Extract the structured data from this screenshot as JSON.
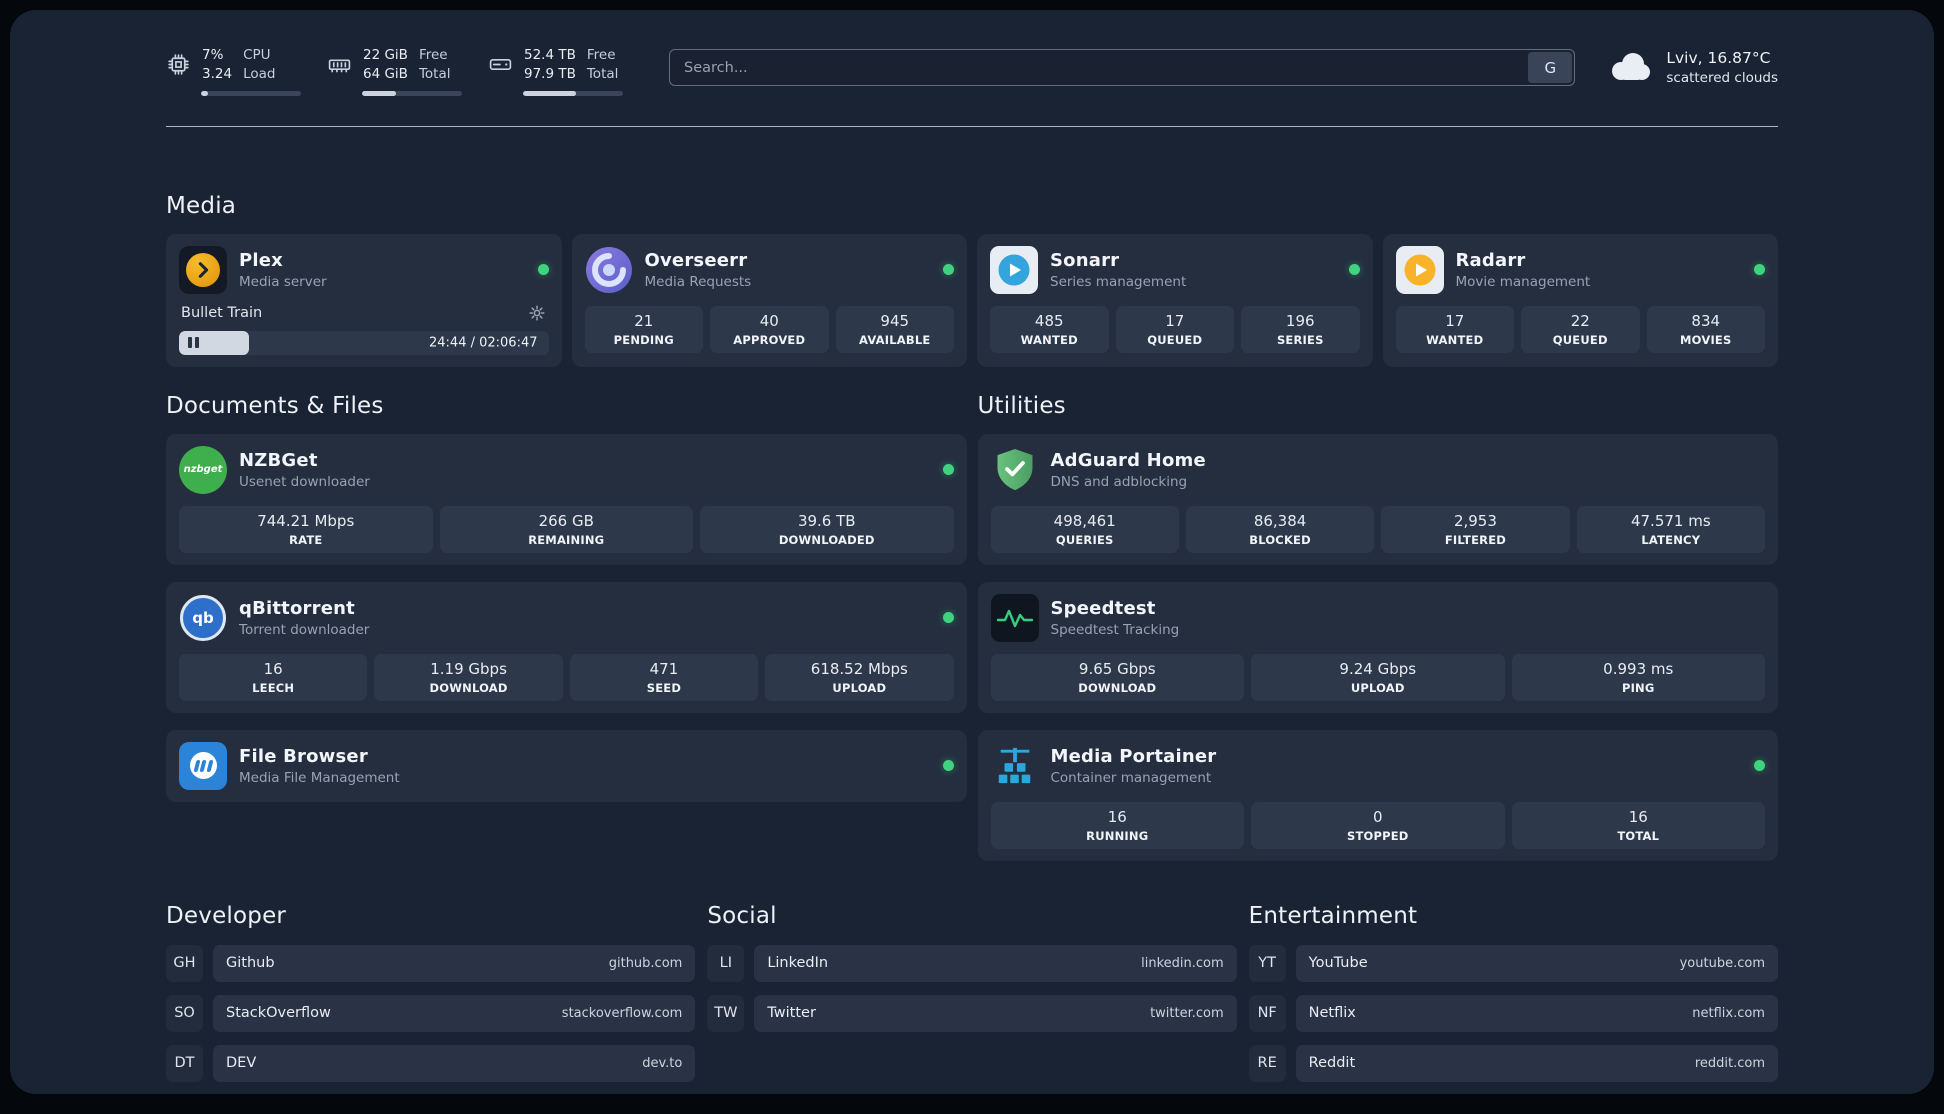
{
  "topbar": {
    "cpu": {
      "value": "7%",
      "value2": "3.24",
      "label1": "CPU",
      "label2": "Load",
      "percent": 7
    },
    "ram": {
      "value": "22 GiB",
      "value2": "64 GiB",
      "label1": "Free",
      "label2": "Total",
      "percent": 34
    },
    "disk": {
      "value": "52.4 TB",
      "value2": "97.9 TB",
      "label1": "Free",
      "label2": "Total",
      "percent": 53
    },
    "search": {
      "placeholder": "Search...",
      "engine_label": "G"
    },
    "weather": {
      "location": "Lviv, 16.87°C",
      "condition": "scattered clouds"
    }
  },
  "sections": {
    "media": {
      "title": "Media",
      "apps": [
        {
          "name": "Plex",
          "desc": "Media server",
          "status": "online",
          "player": {
            "title": "Bullet Train",
            "time": "24:44 / 02:06:47",
            "progress_percent": 19
          }
        },
        {
          "name": "Overseerr",
          "desc": "Media Requests",
          "status": "online",
          "stats": [
            {
              "value": "21",
              "label": "PENDING"
            },
            {
              "value": "40",
              "label": "APPROVED"
            },
            {
              "value": "945",
              "label": "AVAILABLE"
            }
          ]
        },
        {
          "name": "Sonarr",
          "desc": "Series management",
          "status": "online",
          "stats": [
            {
              "value": "485",
              "label": "WANTED"
            },
            {
              "value": "17",
              "label": "QUEUED"
            },
            {
              "value": "196",
              "label": "SERIES"
            }
          ]
        },
        {
          "name": "Radarr",
          "desc": "Movie management",
          "status": "online",
          "stats": [
            {
              "value": "17",
              "label": "WANTED"
            },
            {
              "value": "22",
              "label": "QUEUED"
            },
            {
              "value": "834",
              "label": "MOVIES"
            }
          ]
        }
      ]
    },
    "documents": {
      "title": "Documents & Files",
      "apps": [
        {
          "name": "NZBGet",
          "desc": "Usenet downloader",
          "status": "online",
          "stats": [
            {
              "value": "744.21 Mbps",
              "label": "RATE"
            },
            {
              "value": "266 GB",
              "label": "REMAINING"
            },
            {
              "value": "39.6 TB",
              "label": "DOWNLOADED"
            }
          ]
        },
        {
          "name": "qBittorrent",
          "desc": "Torrent downloader",
          "status": "online",
          "stats": [
            {
              "value": "16",
              "label": "LEECH"
            },
            {
              "value": "1.19 Gbps",
              "label": "DOWNLOAD"
            },
            {
              "value": "471",
              "label": "SEED"
            },
            {
              "value": "618.52 Mbps",
              "label": "UPLOAD"
            }
          ]
        },
        {
          "name": "File Browser",
          "desc": "Media File Management",
          "status": "online"
        }
      ]
    },
    "utilities": {
      "title": "Utilities",
      "apps": [
        {
          "name": "AdGuard Home",
          "desc": "DNS and adblocking",
          "stats": [
            {
              "value": "498,461",
              "label": "QUERIES"
            },
            {
              "value": "86,384",
              "label": "BLOCKED"
            },
            {
              "value": "2,953",
              "label": "FILTERED"
            },
            {
              "value": "47.571 ms",
              "label": "LATENCY"
            }
          ]
        },
        {
          "name": "Speedtest",
          "desc": "Speedtest Tracking",
          "stats": [
            {
              "value": "9.65 Gbps",
              "label": "DOWNLOAD"
            },
            {
              "value": "9.24 Gbps",
              "label": "UPLOAD"
            },
            {
              "value": "0.993 ms",
              "label": "PING"
            }
          ]
        },
        {
          "name": "Media Portainer",
          "desc": "Container management",
          "status": "online",
          "stats": [
            {
              "value": "16",
              "label": "RUNNING"
            },
            {
              "value": "0",
              "label": "STOPPED"
            },
            {
              "value": "16",
              "label": "TOTAL"
            }
          ]
        }
      ]
    }
  },
  "bookmarks": [
    {
      "title": "Developer",
      "links": [
        {
          "abbr": "GH",
          "name": "Github",
          "domain": "github.com"
        },
        {
          "abbr": "SO",
          "name": "StackOverflow",
          "domain": "stackoverflow.com"
        },
        {
          "abbr": "DT",
          "name": "DEV",
          "domain": "dev.to"
        }
      ]
    },
    {
      "title": "Social",
      "links": [
        {
          "abbr": "LI",
          "name": "LinkedIn",
          "domain": "linkedin.com"
        },
        {
          "abbr": "TW",
          "name": "Twitter",
          "domain": "twitter.com"
        }
      ]
    },
    {
      "title": "Entertainment",
      "links": [
        {
          "abbr": "YT",
          "name": "YouTube",
          "domain": "youtube.com"
        },
        {
          "abbr": "NF",
          "name": "Netflix",
          "domain": "netflix.com"
        },
        {
          "abbr": "RE",
          "name": "Reddit",
          "domain": "reddit.com"
        }
      ]
    }
  ],
  "colors": {
    "background": "#1a2333",
    "card": "#242e3f",
    "stat_block": "#2d384b",
    "status_green": "#3fd37f",
    "plex_amber": "#e5a00d",
    "overseerr_purple": "#6f6bd4",
    "sonarr_blue": "#33a4dc",
    "radarr_gold": "#f9b32a",
    "nzbget_green": "#3fae4c",
    "qbittorrent_blue": "#2e6fc9",
    "filebrowser_blue": "#2b84d8",
    "adguard_green": "#5fb873",
    "speedtest_green": "#35d07f",
    "portainer_blue": "#2aa7dd"
  },
  "icons": [
    "cpu-icon",
    "ram-icon",
    "disk-icon",
    "search-engine-g",
    "cloud-icon",
    "plex-icon",
    "overseerr-icon",
    "sonarr-icon",
    "radarr-icon",
    "nzbget-icon",
    "qbittorrent-icon",
    "filebrowser-icon",
    "adguard-icon",
    "speedtest-icon",
    "portainer-icon",
    "gear-icon",
    "pause-icon",
    "status-dot"
  ]
}
